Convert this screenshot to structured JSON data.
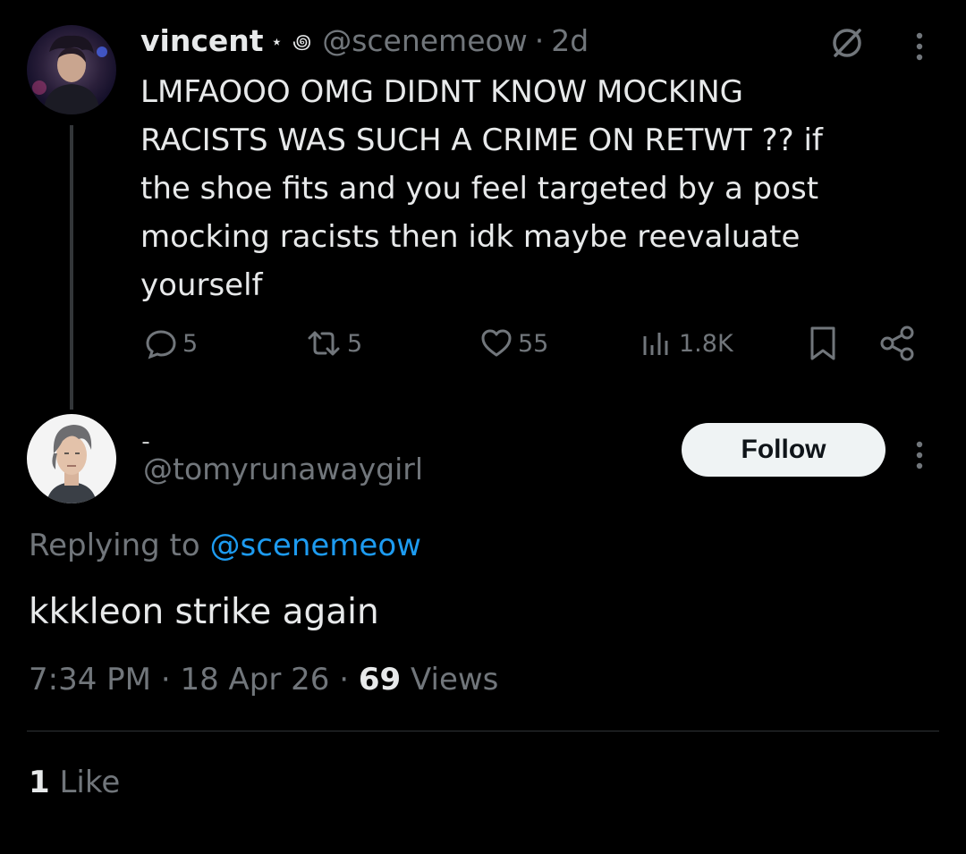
{
  "post": {
    "display_name": "vincent",
    "badge": "⋆ ꩜",
    "handle": "@scenemeow",
    "separator": "·",
    "time_ago": "2d",
    "text": "LMFAOOO OMG DIDNT KNOW MOCKING\nRACISTS WAS SUCH A CRIME ON RETWT ?? if\nthe shoe fits and you feel targeted by a post\nmocking racists then idk maybe reevaluate\nyourself",
    "replies": "5",
    "reposts": "5",
    "likes": "55",
    "views": "1.8K",
    "icons": [
      "grok-icon",
      "more-icon",
      "reply-icon",
      "repost-icon",
      "like-icon",
      "views-icon",
      "bookmark-icon",
      "share-icon"
    ]
  },
  "reply": {
    "display_name": "ˍ",
    "handle": "@tomyrunawaygirl",
    "follow_label": "Follow",
    "replying_prefix": "Replying to",
    "replying_mention": "@scenemeow",
    "text": "kkkleon strike again",
    "time": "7:34 PM",
    "date": "18 Apr 26",
    "views_count": "69",
    "views_label": "Views",
    "sep": "·",
    "likes_count": "1",
    "likes_label": "Like"
  },
  "colors": {
    "background": "#000000",
    "text": "#e7e9ea",
    "muted": "#71767b",
    "link": "#1d9bf0",
    "divider": "#2f3336"
  }
}
